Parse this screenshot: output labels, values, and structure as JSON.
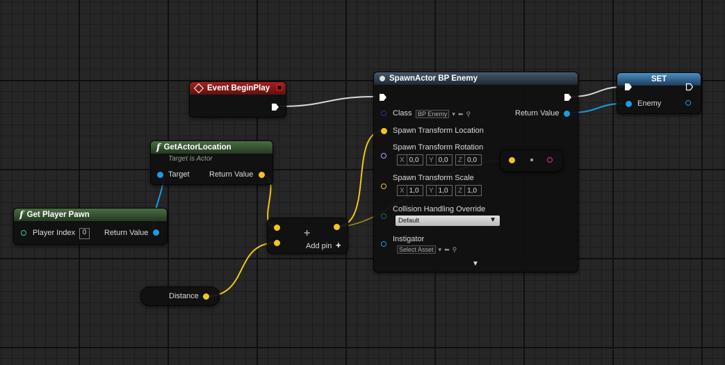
{
  "nodes": {
    "event_begin_play": {
      "title": "Event BeginPlay"
    },
    "get_actor_location": {
      "title": "GetActorLocation",
      "subtitle": "Target is Actor",
      "target_label": "Target",
      "return_label": "Return Value"
    },
    "get_player_pawn": {
      "title": "Get Player Pawn",
      "player_index_label": "Player Index",
      "player_index_value": "0",
      "return_label": "Return Value"
    },
    "add": {
      "symbol": "+",
      "add_pin_label": "Add pin",
      "add_pin_icon": "+"
    },
    "distance": {
      "label": "Distance"
    },
    "spawn_actor": {
      "title": "SpawnActor BP Enemy",
      "class_label": "Class",
      "class_value": "BP Enemy",
      "return_label": "Return Value",
      "location_label": "Spawn Transform Location",
      "rotation_label": "Spawn Transform Rotation",
      "rotation": [
        {
          "axis": "X",
          "value": "0,0"
        },
        {
          "axis": "Y",
          "value": "0,0"
        },
        {
          "axis": "Z",
          "value": "0,0"
        }
      ],
      "scale_label": "Spawn Transform Scale",
      "scale": [
        {
          "axis": "X",
          "value": "1,0"
        },
        {
          "axis": "Y",
          "value": "1,0"
        },
        {
          "axis": "Z",
          "value": "1,0"
        }
      ],
      "collision_label": "Collision Handling Override",
      "collision_value": "Default",
      "instigator_label": "Instigator",
      "instigator_value": "Select Asset"
    },
    "set": {
      "title": "SET",
      "enemy_label": "Enemy"
    }
  },
  "colors": {
    "exec": "#ffffff",
    "vector": "#f5c518",
    "object": "#1d9be3",
    "integer": "#2fd2a4",
    "class": "#5a1aa0",
    "rotator": "#9ab4f0",
    "collision": "#1d6e63",
    "pink": "#e02a9c"
  }
}
